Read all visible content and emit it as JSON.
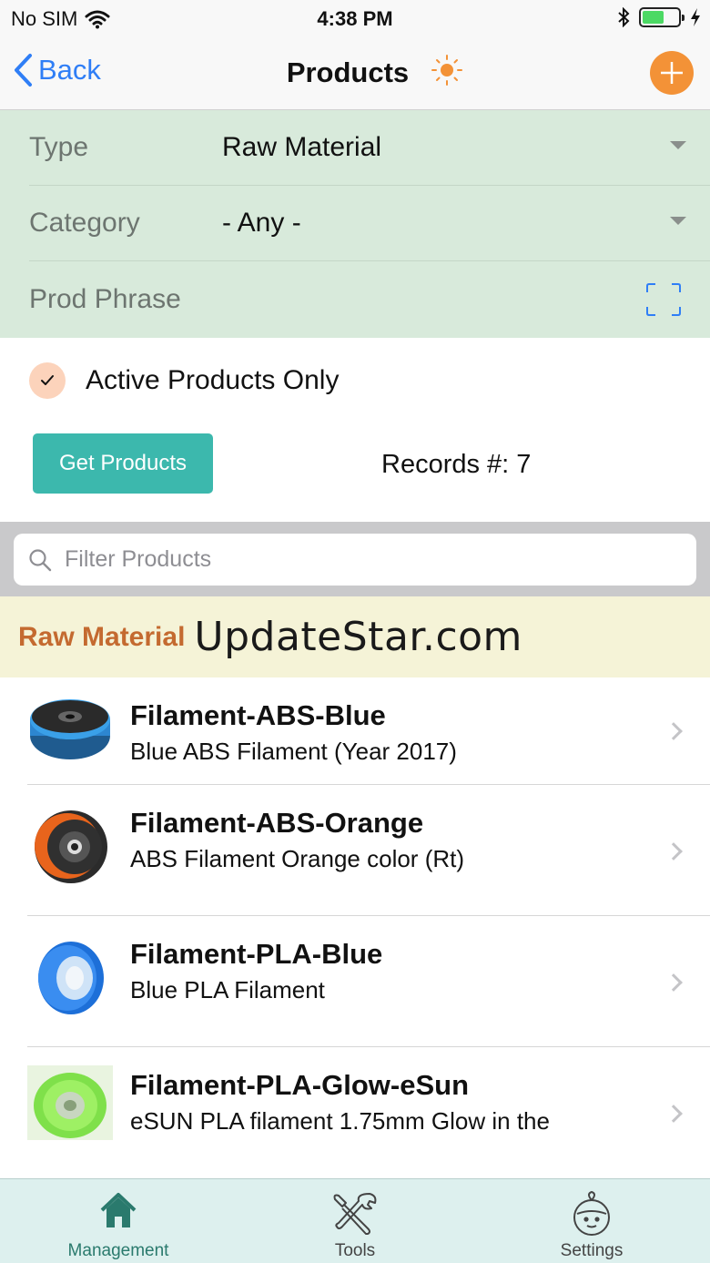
{
  "status_bar": {
    "carrier": "No SIM",
    "time": "4:38 PM"
  },
  "nav": {
    "back_label": "Back",
    "title": "Products"
  },
  "filters": {
    "type_label": "Type",
    "type_value": "Raw Material",
    "category_label": "Category",
    "category_value": "- Any -",
    "phrase_placeholder": "Prod Phrase"
  },
  "active_only": {
    "label": "Active Products Only",
    "checked": true
  },
  "actions": {
    "get_products_label": "Get Products",
    "records_label": "Records #:",
    "records_count": "7"
  },
  "search": {
    "placeholder": "Filter Products"
  },
  "section": {
    "title": "Raw Material",
    "watermark": "UpdateStar.com"
  },
  "products": [
    {
      "name": "Filament-ABS-Blue",
      "description": "Blue ABS Filament (Year 2017)",
      "thumb": "blue-spool"
    },
    {
      "name": "Filament-ABS-Orange",
      "description": "ABS Filament Orange color (Rt)",
      "thumb": "orange-spool"
    },
    {
      "name": "Filament-PLA-Blue",
      "description": "Blue PLA Filament",
      "thumb": "blue-pla-spool"
    },
    {
      "name": "Filament-PLA-Glow-eSun",
      "description": "eSUN PLA filament 1.75mm Glow in the",
      "thumb": "green-spool"
    }
  ],
  "tabs": [
    {
      "label": "Management",
      "icon": "home-icon",
      "active": true
    },
    {
      "label": "Tools",
      "icon": "tools-icon",
      "active": false
    },
    {
      "label": "Settings",
      "icon": "settings-face-icon",
      "active": false
    }
  ],
  "colors": {
    "accent_blue": "#2f7ef6",
    "add_orange": "#f39237",
    "filter_bg": "#d8eadb",
    "button_teal": "#3cb8ad",
    "section_bg": "#f5f3d7",
    "section_title": "#c46a30",
    "tab_active": "#2a7a6d"
  }
}
